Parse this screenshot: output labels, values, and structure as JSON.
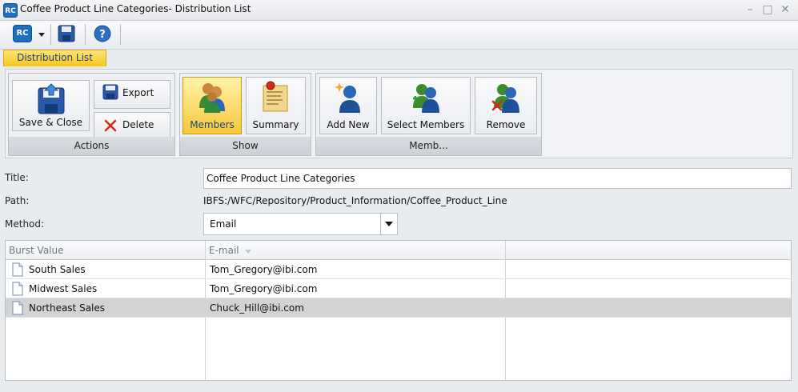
{
  "window": {
    "title": "Coffee Product Line Categories- Distribution List",
    "app_badge": "RC"
  },
  "quickbar": {
    "rc_badge": "RC"
  },
  "tab": {
    "label": "Distribution List"
  },
  "ribbon": {
    "actions": {
      "label": "Actions",
      "save_close": "Save & Close",
      "export": "Export",
      "delete": "Delete"
    },
    "show": {
      "label": "Show",
      "members": "Members",
      "summary": "Summary"
    },
    "members_group": {
      "label": "Memb...",
      "add_new": "Add New",
      "select_members": "Select Members",
      "remove": "Remove"
    }
  },
  "form": {
    "title_label": "Title:",
    "title_value": "Coffee Product Line Categories",
    "path_label": "Path:",
    "path_value": "IBFS:/WFC/Repository/Product_Information/Coffee_Product_Line",
    "method_label": "Method:",
    "method_value": "Email"
  },
  "grid": {
    "columns": [
      "Burst Value",
      "E-mail"
    ],
    "rows": [
      {
        "burst": "South Sales",
        "email": "Tom_Gregory@ibi.com"
      },
      {
        "burst": "Midwest Sales",
        "email": "Tom_Gregory@ibi.com"
      },
      {
        "burst": "Northeast Sales",
        "email": "Chuck_Hill@ibi.com"
      }
    ],
    "selected_row": 2
  },
  "colors": {
    "accent": "#f7c61e",
    "selection": "#d3d3d3"
  }
}
